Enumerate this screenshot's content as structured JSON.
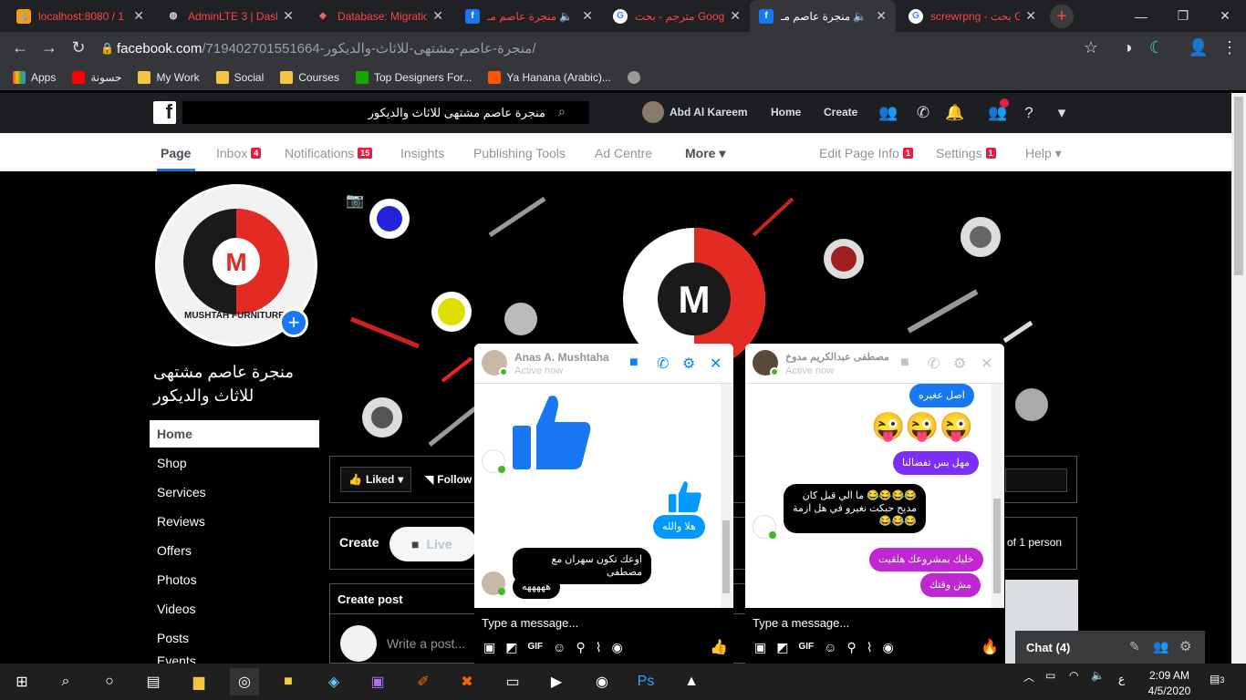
{
  "browser": {
    "tabs": [
      {
        "title": "localhost:8080 / 1",
        "favicon": "pma"
      },
      {
        "title": "AdminLTE 3 | Dash",
        "favicon": "globe"
      },
      {
        "title": "Database: Migratio",
        "favicon": "laravel"
      },
      {
        "title": "منجرة عاصم مـ",
        "favicon": "facebook"
      },
      {
        "title": "مترجم - بحث Google",
        "favicon": "google"
      },
      {
        "title": "منجرة عاصم مـ",
        "favicon": "facebook"
      },
      {
        "title": "screwrpng - بحث G",
        "favicon": "google"
      }
    ],
    "url_host": "facebook.com",
    "url_path": "/719402701551664-منجرة-عاصم-مشتهى-للاثاث-والديكور/",
    "bookmarks": [
      "Apps",
      "حسونة",
      "My Work",
      "Social",
      "Courses",
      "Top Designers For...",
      "Ya Hanana (Arabic)..."
    ]
  },
  "fb": {
    "search_value": "منجرة عاصم مشتهى للاثاث والديكور",
    "user": "Abd Al Kareem",
    "home": "Home",
    "create": "Create"
  },
  "page_tabs": [
    {
      "label": "Page"
    },
    {
      "label": "Inbox",
      "badge": "4"
    },
    {
      "label": "Notifications",
      "badge": "15"
    },
    {
      "label": "Insights"
    },
    {
      "label": "Publishing Tools"
    },
    {
      "label": "Ad Centre"
    },
    {
      "label": "More ▾"
    },
    {
      "label": "Edit Page Info",
      "badge": "1"
    },
    {
      "label": "Settings",
      "badge": "1"
    },
    {
      "label": "Help ▾"
    }
  ],
  "page": {
    "name": "منجرة عاصم مشتهى للاثاث والديكور",
    "logo_text": "MUSHTAH FURNITURE",
    "nav": [
      "Home",
      "Shop",
      "Services",
      "Reviews",
      "Offers",
      "Photos",
      "Videos",
      "Posts",
      "Events"
    ],
    "liked": "Liked",
    "follow": "Follow",
    "create": "Create",
    "live": "Live",
    "person_text": "of 1 person",
    "create_post": "Create post",
    "write_post": "Write a post..."
  },
  "chat1": {
    "name": "Anas A. Mushtaha",
    "status": "Active now",
    "msg_hala": "هلا والله",
    "msg_long": "اوعك تكون سهران مع مصطفى",
    "msg_laugh": "هههههه",
    "input_placeholder": "Type a message..."
  },
  "chat2": {
    "name": "مصطفى عبدالكريم مدوخ",
    "status": "Active now",
    "msg1": "اصل عغيره",
    "emoji": "😜😜😜",
    "msg2": "مهل بس تفضالنا",
    "msg3": "😂😂😂😂 ما الي قبل كان مديح حبكت نغيرو في هل ازمة 😂😂😂",
    "msg4": "خليك بمشروعك هلقيت",
    "msg5": "مش وقتك",
    "input_placeholder": "Type a message..."
  },
  "dock": {
    "label": "Chat (4)"
  },
  "taskbar": {
    "time": "2:09 AM",
    "date": "4/5/2020",
    "lang": "ع",
    "notif": "3"
  },
  "colors": {
    "fb_blue": "#1877f2",
    "chat_blue": "#0099ff",
    "bubble_purple": "#7b2ff7",
    "bubble_magenta": "#c026d3",
    "brand_red": "#e32b23"
  }
}
